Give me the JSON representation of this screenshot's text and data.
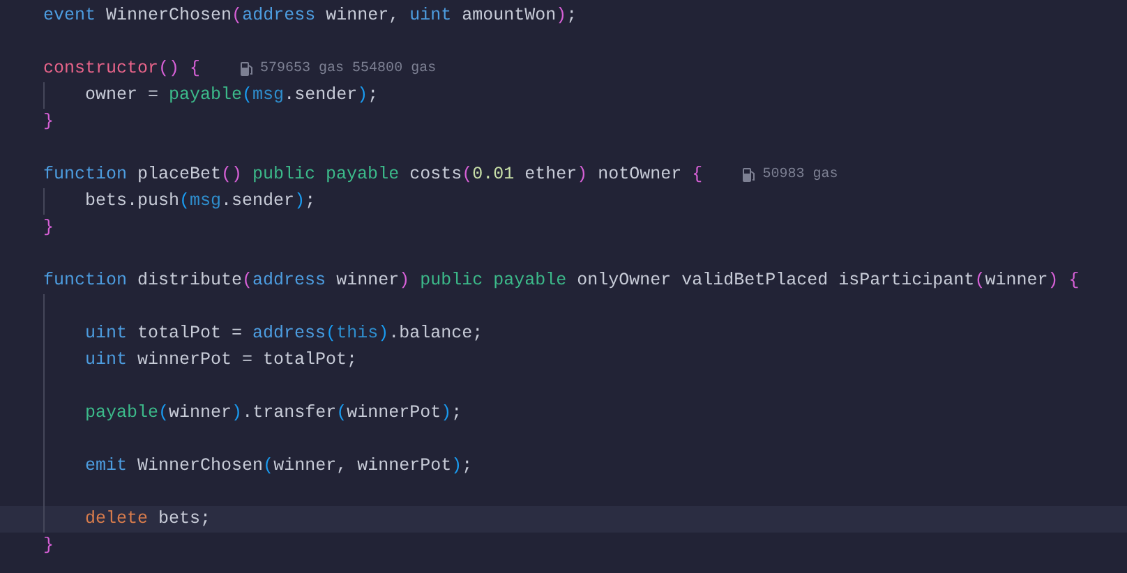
{
  "lines": [
    {
      "highlighted": false,
      "tokens": [
        {
          "kind": "keyword",
          "text": "event"
        },
        {
          "kind": "plain",
          "text": " WinnerChosen"
        },
        {
          "kind": "bracket1",
          "text": "("
        },
        {
          "kind": "keyword",
          "text": "address"
        },
        {
          "kind": "plain",
          "text": " winner, "
        },
        {
          "kind": "keyword",
          "text": "uint"
        },
        {
          "kind": "plain",
          "text": " amountWon"
        },
        {
          "kind": "bracket1",
          "text": ")"
        },
        {
          "kind": "plain",
          "text": ";"
        }
      ]
    },
    {
      "blank_before": true,
      "highlighted": false,
      "tokens": [
        {
          "kind": "special",
          "text": "constructor"
        },
        {
          "kind": "bracket1",
          "text": "()"
        },
        {
          "kind": "bracket1",
          "text": " {"
        }
      ],
      "gas_hint": "579653 gas 554800 gas",
      "children": [
        {
          "highlighted": false,
          "tokens": [
            {
              "kind": "plain",
              "text": "owner = "
            },
            {
              "kind": "modifier",
              "text": "payable"
            },
            {
              "kind": "bracket2",
              "text": "("
            },
            {
              "kind": "builtin",
              "text": "msg"
            },
            {
              "kind": "plain",
              "text": ".sender"
            },
            {
              "kind": "bracket2",
              "text": ")"
            },
            {
              "kind": "plain",
              "text": ";"
            }
          ]
        }
      ]
    },
    {
      "highlighted": false,
      "tokens": [
        {
          "kind": "bracket1",
          "text": "}"
        }
      ]
    },
    {
      "blank_before": true,
      "highlighted": false,
      "tokens": [
        {
          "kind": "keyword",
          "text": "function"
        },
        {
          "kind": "plain",
          "text": " placeBet"
        },
        {
          "kind": "bracket1",
          "text": "()"
        },
        {
          "kind": "modifier",
          "text": " public payable"
        },
        {
          "kind": "plain",
          "text": " costs"
        },
        {
          "kind": "bracket1",
          "text": "("
        },
        {
          "kind": "number",
          "text": "0.01"
        },
        {
          "kind": "plain",
          "text": " ether"
        },
        {
          "kind": "bracket1",
          "text": ")"
        },
        {
          "kind": "plain",
          "text": " notOwner "
        },
        {
          "kind": "bracket1",
          "text": "{"
        }
      ],
      "gas_hint": "50983 gas",
      "children": [
        {
          "highlighted": false,
          "tokens": [
            {
              "kind": "plain",
              "text": "bets.push"
            },
            {
              "kind": "bracket2",
              "text": "("
            },
            {
              "kind": "builtin",
              "text": "msg"
            },
            {
              "kind": "plain",
              "text": ".sender"
            },
            {
              "kind": "bracket2",
              "text": ")"
            },
            {
              "kind": "plain",
              "text": ";"
            }
          ]
        }
      ]
    },
    {
      "highlighted": false,
      "tokens": [
        {
          "kind": "bracket1",
          "text": "}"
        }
      ]
    },
    {
      "blank_before": true,
      "highlighted": false,
      "tokens": [
        {
          "kind": "keyword",
          "text": "function"
        },
        {
          "kind": "plain",
          "text": " distribute"
        },
        {
          "kind": "bracket1",
          "text": "("
        },
        {
          "kind": "keyword",
          "text": "address"
        },
        {
          "kind": "plain",
          "text": " winner"
        },
        {
          "kind": "bracket1",
          "text": ")"
        },
        {
          "kind": "modifier",
          "text": " public payable"
        },
        {
          "kind": "plain",
          "text": " onlyOwner validBetPlaced isParticipant"
        },
        {
          "kind": "bracket1",
          "text": "("
        },
        {
          "kind": "plain",
          "text": "winner"
        },
        {
          "kind": "bracket1",
          "text": ")"
        },
        {
          "kind": "bracket1",
          "text": " {"
        }
      ],
      "children": [
        {
          "blank_before": true,
          "highlighted": false,
          "tokens": [
            {
              "kind": "keyword",
              "text": "uint"
            },
            {
              "kind": "plain",
              "text": " totalPot = "
            },
            {
              "kind": "keyword",
              "text": "address"
            },
            {
              "kind": "bracket2",
              "text": "("
            },
            {
              "kind": "builtin",
              "text": "this"
            },
            {
              "kind": "bracket2",
              "text": ")"
            },
            {
              "kind": "plain",
              "text": ".balance;"
            }
          ]
        },
        {
          "highlighted": false,
          "tokens": [
            {
              "kind": "keyword",
              "text": "uint"
            },
            {
              "kind": "plain",
              "text": " winnerPot = totalPot;"
            }
          ]
        },
        {
          "blank_before": true,
          "highlighted": false,
          "tokens": [
            {
              "kind": "modifier",
              "text": "payable"
            },
            {
              "kind": "bracket2",
              "text": "("
            },
            {
              "kind": "plain",
              "text": "winner"
            },
            {
              "kind": "bracket2",
              "text": ")"
            },
            {
              "kind": "plain",
              "text": ".transfer"
            },
            {
              "kind": "bracket2",
              "text": "("
            },
            {
              "kind": "plain",
              "text": "winnerPot"
            },
            {
              "kind": "bracket2",
              "text": ")"
            },
            {
              "kind": "plain",
              "text": ";"
            }
          ]
        },
        {
          "blank_before": true,
          "highlighted": false,
          "tokens": [
            {
              "kind": "keyword",
              "text": "emit"
            },
            {
              "kind": "plain",
              "text": " WinnerChosen"
            },
            {
              "kind": "bracket2",
              "text": "("
            },
            {
              "kind": "plain",
              "text": "winner, winnerPot"
            },
            {
              "kind": "bracket2",
              "text": ")"
            },
            {
              "kind": "plain",
              "text": ";"
            }
          ]
        },
        {
          "blank_before": true,
          "highlighted": true,
          "tokens": [
            {
              "kind": "control",
              "text": "delete"
            },
            {
              "kind": "plain",
              "text": " bets;"
            }
          ]
        }
      ]
    },
    {
      "highlighted": false,
      "tokens": [
        {
          "kind": "bracket1",
          "text": "}"
        }
      ]
    }
  ]
}
